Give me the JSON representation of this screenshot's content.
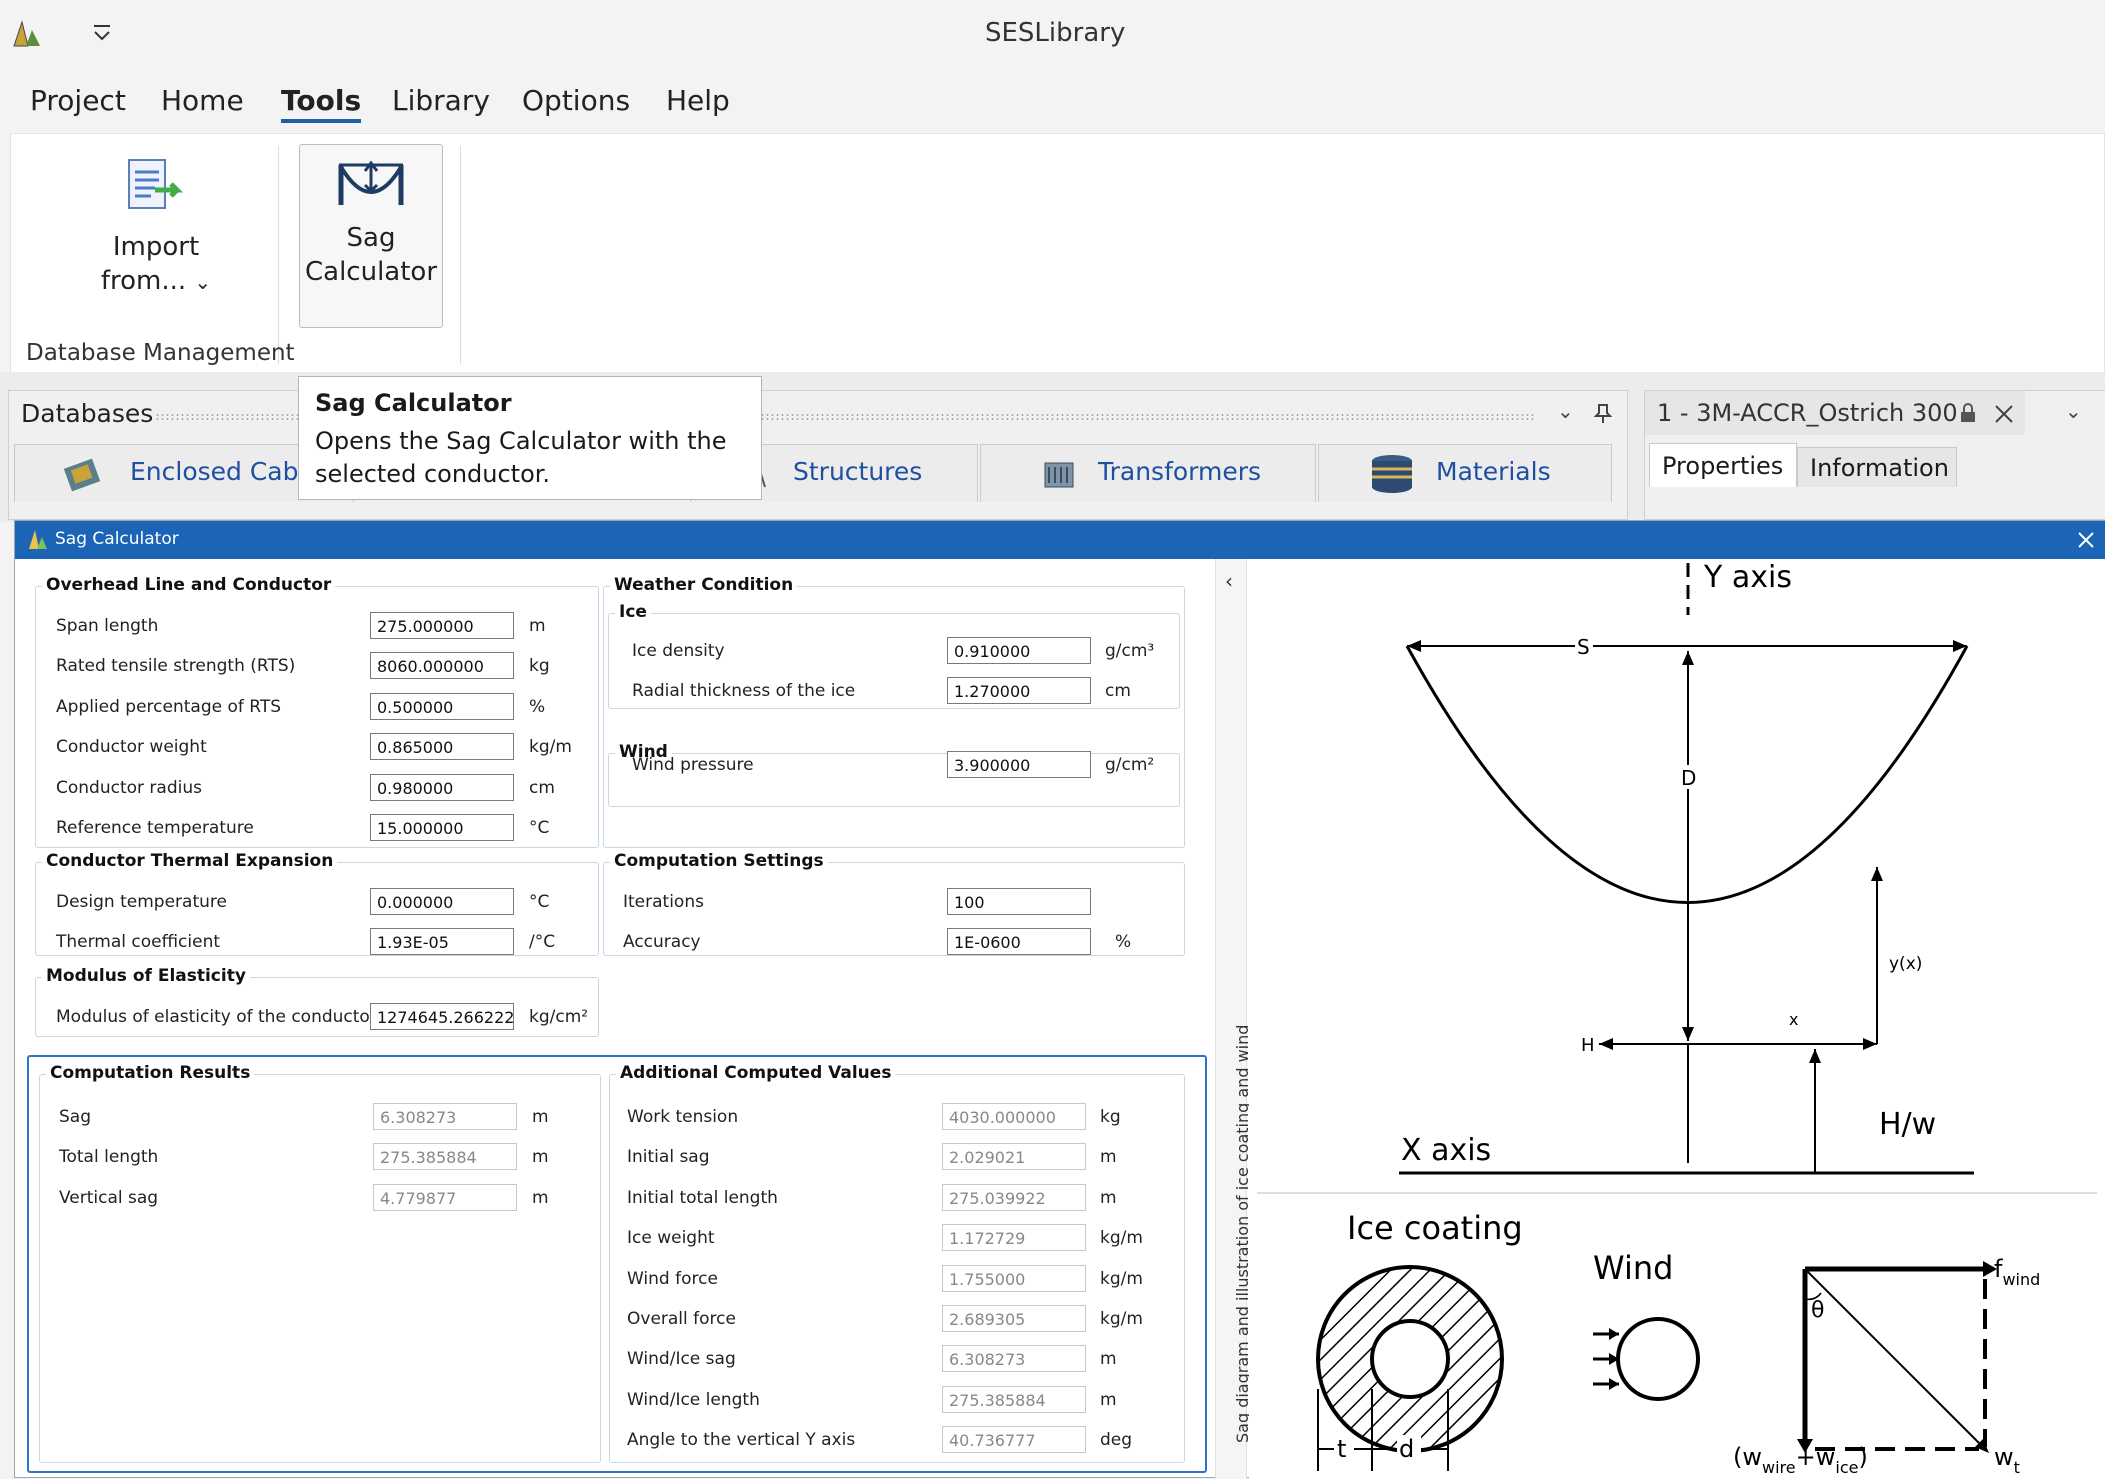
{
  "app": {
    "title": "SESLibrary"
  },
  "menu": {
    "items": [
      "Project",
      "Home",
      "Tools",
      "Library",
      "Options",
      "Help"
    ],
    "active": "Tools"
  },
  "ribbon": {
    "import_label_1": "Import",
    "import_label_2": "from...",
    "sag_label_1": "Sag",
    "sag_label_2": "Calculator",
    "group_label": "Database Management"
  },
  "databases": {
    "title": "Databases",
    "tabs": [
      "Enclosed Cable",
      "Structures",
      "Transformers",
      "Materials"
    ]
  },
  "doc_panel": {
    "title": "1 - 3M-ACCR_Ostrich 300",
    "tabs": [
      "Properties",
      "Information"
    ]
  },
  "tooltip": {
    "title": "Sag Calculator",
    "line1": "Opens the Sag Calculator with the",
    "line2": "selected conductor."
  },
  "dialog": {
    "title": "Sag Calculator",
    "overhead": {
      "title": "Overhead Line and Conductor",
      "rows": [
        {
          "label": "Span length",
          "value": "275.000000",
          "unit": "m"
        },
        {
          "label": "Rated tensile strength (RTS)",
          "value": "8060.000000",
          "unit": "kg"
        },
        {
          "label": "Applied percentage of RTS",
          "value": "0.500000",
          "unit": "%"
        },
        {
          "label": "Conductor weight",
          "value": "0.865000",
          "unit": "kg/m"
        },
        {
          "label": "Conductor radius",
          "value": "0.980000",
          "unit": "cm"
        },
        {
          "label": "Reference temperature",
          "value": "15.000000",
          "unit": "°C"
        }
      ]
    },
    "weather": {
      "title": "Weather Condition",
      "ice": {
        "title": "Ice",
        "rows": [
          {
            "label": "Ice density",
            "value": "0.910000",
            "unit": "g/cm³"
          },
          {
            "label": "Radial thickness of the ice",
            "value": "1.270000",
            "unit": "cm"
          }
        ]
      },
      "wind": {
        "title": "Wind",
        "rows": [
          {
            "label": "Wind pressure",
            "value": "3.900000",
            "unit": "g/cm²"
          }
        ]
      }
    },
    "thermal": {
      "title": "Conductor Thermal Expansion",
      "rows": [
        {
          "label": "Design temperature",
          "value": "0.000000",
          "unit": "°C"
        },
        {
          "label": "Thermal coefficient",
          "value": "1.93E-05",
          "unit": "/°C"
        }
      ]
    },
    "computation": {
      "title": "Computation Settings",
      "rows": [
        {
          "label": "Iterations",
          "value": "100",
          "unit": ""
        },
        {
          "label": "Accuracy",
          "value": "1E-0600",
          "unit": "%"
        }
      ]
    },
    "modulus": {
      "title": "Modulus of Elasticity",
      "rows": [
        {
          "label": "Modulus of elasticity of the conductor",
          "value": "1274645.266222",
          "unit": "kg/cm²"
        }
      ]
    },
    "results": {
      "title": "Computation Results",
      "rows": [
        {
          "label": "Sag",
          "value": "6.308273",
          "unit": "m"
        },
        {
          "label": "Total length",
          "value": "275.385884",
          "unit": "m"
        },
        {
          "label": "Vertical sag",
          "value": "4.779877",
          "unit": "m"
        }
      ]
    },
    "additional": {
      "title": "Additional Computed Values",
      "rows": [
        {
          "label": "Work tension",
          "value": "4030.000000",
          "unit": "kg"
        },
        {
          "label": "Initial sag",
          "value": "2.029021",
          "unit": "m"
        },
        {
          "label": "Initial total length",
          "value": "275.039922",
          "unit": "m"
        },
        {
          "label": "Ice weight",
          "value": "1.172729",
          "unit": "kg/m"
        },
        {
          "label": "Wind force",
          "value": "1.755000",
          "unit": "kg/m"
        },
        {
          "label": "Overall force",
          "value": "2.689305",
          "unit": "kg/m"
        },
        {
          "label": "Wind/Ice sag",
          "value": "6.308273",
          "unit": "m"
        },
        {
          "label": "Wind/Ice length",
          "value": "275.385884",
          "unit": "m"
        },
        {
          "label": "Angle to the vertical Y axis",
          "value": "40.736777",
          "unit": "deg"
        }
      ]
    },
    "side_label": "Sag diagram and illustration of ice coating and wind"
  },
  "diagram": {
    "y_axis": "Y axis",
    "x_axis": "X axis",
    "s": "S",
    "d": "D",
    "h": "H",
    "yx": "y(x)",
    "x": "x",
    "hw": "H/w",
    "ice_coating": "Ice coating",
    "wind": "Wind",
    "t": "t",
    "d_small": "d",
    "theta": "θ",
    "f_wind": "f",
    "f_wind_sub": "wind",
    "w_t": "w",
    "w_t_sub": "t",
    "w_wire": "w",
    "w_wire_sub": "wire",
    "w_ice": "w",
    "w_ice_sub": "ice"
  },
  "colors": {
    "accent": "#1b64b6",
    "link": "#1f4fa0"
  }
}
